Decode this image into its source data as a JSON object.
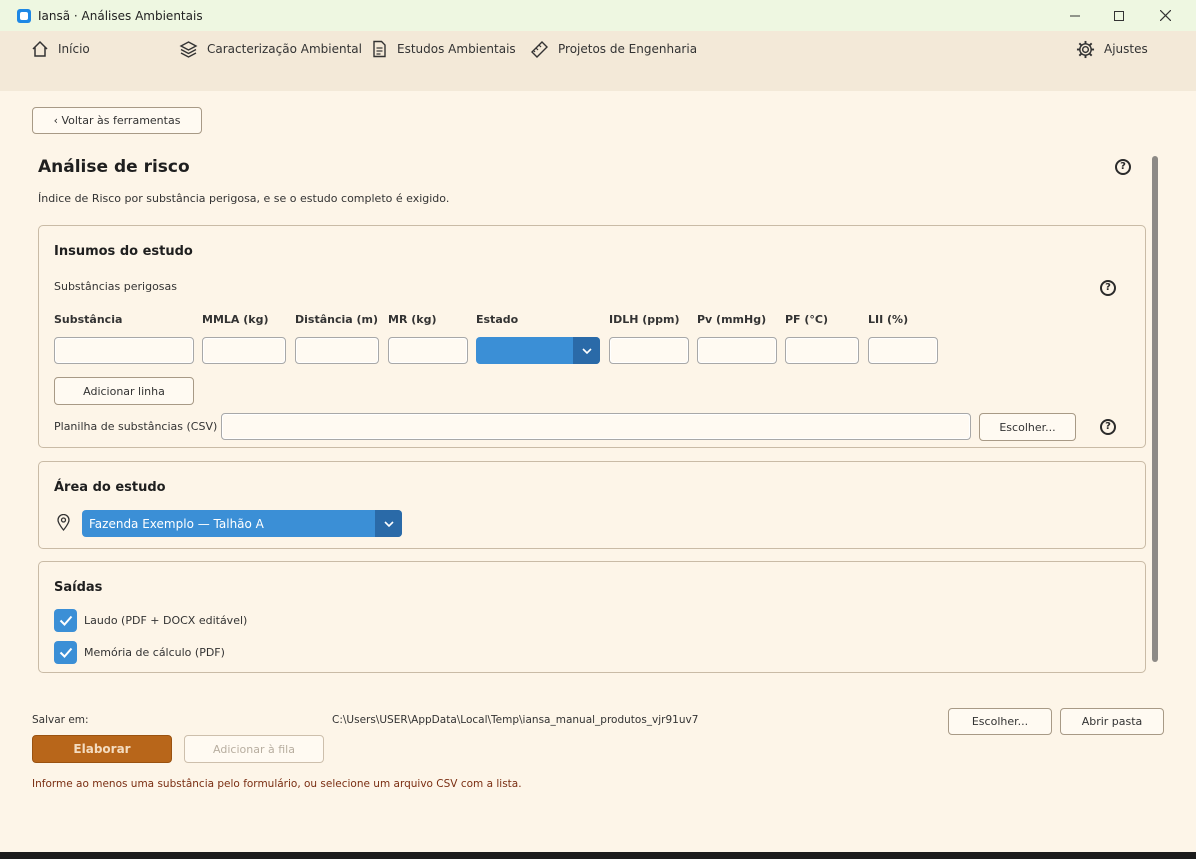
{
  "window": {
    "title": "Iansã · Análises Ambientais",
    "minimize": "—",
    "maximize": "☐",
    "close": "✕"
  },
  "nav": {
    "home": "Início",
    "environmental": "Caracterização Ambiental",
    "studies": "Estudos Ambientais",
    "engineering": "Projetos de Engenharia",
    "settings": "Ajustes"
  },
  "back_button": "‹ Voltar às ferramentas",
  "page": {
    "title": "Análise de risco",
    "subtitle": "Índice de Risco por substância perigosa, e se o estudo completo é exigido.",
    "help": "?"
  },
  "inputs": {
    "title": "Insumos do estudo",
    "substances_label": "Substâncias perigosas",
    "columns": [
      "Substância",
      "MMLA (kg)",
      "Distância (m)",
      "MR (kg)",
      "Estado",
      "IDLH (ppm)",
      "Pv (mmHg)",
      "PF (°C)",
      "LII (%)"
    ],
    "add_row": "Adicionar linha",
    "csv_label": "Planilha de substâncias (CSV)",
    "csv_value": "",
    "choose": "Escolher..."
  },
  "area": {
    "title": "Área do estudo",
    "selected": "Fazenda Exemplo — Talhão A"
  },
  "outputs": {
    "title": "Saídas",
    "items": [
      {
        "label": "Laudo (PDF + DOCX editável)",
        "checked": true
      },
      {
        "label": "Memória de cálculo (PDF)",
        "checked": true
      }
    ]
  },
  "footer": {
    "save_label": "Salvar em:",
    "save_path": "C:\\Users\\USER\\AppData\\Local\\Temp\\iansa_manual_produtos_vjr91uv7",
    "choose": "Escolher...",
    "open_folder": "Abrir pasta",
    "elaborate": "Elaborar",
    "queue": "Adicionar à fila",
    "warning": "Informe ao menos uma substância pelo formulário, ou selecione um arquivo CSV com a lista."
  },
  "colors": {
    "accent": "#b8661a",
    "select": "#3b8fd6",
    "warning": "#7a2e12"
  }
}
